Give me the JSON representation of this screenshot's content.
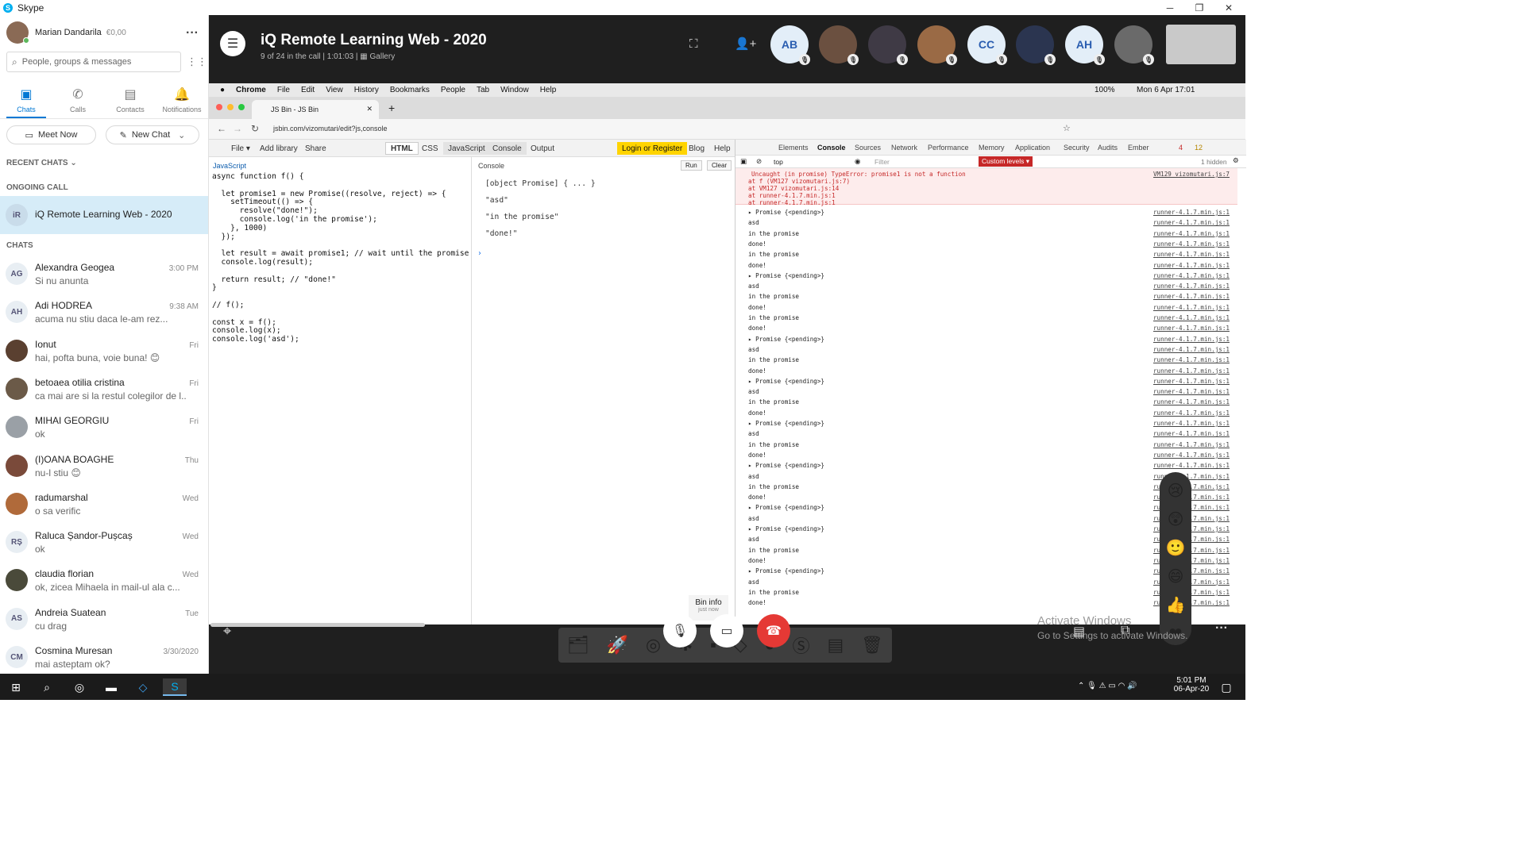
{
  "window": {
    "title": "Skype"
  },
  "profile": {
    "name": "Marian Dandarila",
    "credit": "€0,00"
  },
  "search": {
    "placeholder": "People, groups & messages"
  },
  "nav": [
    {
      "label": "Chats"
    },
    {
      "label": "Calls"
    },
    {
      "label": "Contacts"
    },
    {
      "label": "Notifications"
    }
  ],
  "buttons": {
    "meet_now": "Meet Now",
    "new_chat": "New Chat"
  },
  "sections": {
    "recent": "RECENT CHATS",
    "ongoing": "ONGOING CALL",
    "chats": "CHATS"
  },
  "ongoing_call": {
    "initials": "iR",
    "name": "iQ Remote Learning Web - 2020"
  },
  "chats": [
    {
      "initials": "AG",
      "name": "Alexandra Geogea",
      "msg": "Si nu anunta",
      "time": "3:00 PM",
      "color": "#e8eef3"
    },
    {
      "initials": "AH",
      "name": "Adi HODREA",
      "msg": "acuma nu stiu daca le-am rez...",
      "time": "9:38 AM",
      "color": "#e8eef3"
    },
    {
      "initials": "",
      "name": "Ionut",
      "msg": "hai, pofta buna, voie buna! 😊",
      "time": "Fri",
      "color": "#5a4030"
    },
    {
      "initials": "",
      "name": "betoaea otilia cristina",
      "msg": "ca mai are si la restul colegilor de l...",
      "time": "Fri",
      "color": "#6b5a48"
    },
    {
      "initials": "",
      "name": "MIHAI GEORGIU",
      "msg": "ok",
      "time": "Fri",
      "color": "#9aa0a6"
    },
    {
      "initials": "",
      "name": "(I)OANA BOAGHE",
      "msg": "nu-l stiu 😊",
      "time": "Thu",
      "color": "#7a4a3a"
    },
    {
      "initials": "",
      "name": "radumarshal",
      "msg": "o sa verific",
      "time": "Wed",
      "color": "#b06a3a"
    },
    {
      "initials": "RȘ",
      "name": "Raluca Șandor-Pușcaș",
      "msg": "ok",
      "time": "Wed",
      "color": "#e8eef3"
    },
    {
      "initials": "",
      "name": "claudia florian",
      "msg": "ok, zicea Mihaela in mail-ul ala c...",
      "time": "Wed",
      "color": "#4a4a3a"
    },
    {
      "initials": "AS",
      "name": "Andreia Suatean",
      "msg": "cu drag",
      "time": "Tue",
      "color": "#e8eef3"
    },
    {
      "initials": "CM",
      "name": "Cosmina Muresan",
      "msg": "mai asteptam ok?",
      "time": "3/30/2020",
      "color": "#e8eef3"
    }
  ],
  "call": {
    "title": "iQ Remote Learning Web - 2020",
    "subtitle": "9 of 24 in the call | 1:01:03 |",
    "view": "Gallery"
  },
  "participants": [
    {
      "initials": "AB"
    },
    {
      "initials": ""
    },
    {
      "initials": ""
    },
    {
      "initials": ""
    },
    {
      "initials": "CC"
    },
    {
      "initials": ""
    },
    {
      "initials": "AH"
    },
    {
      "initials": ""
    }
  ],
  "mac_menu": {
    "app": "Chrome",
    "items": [
      "File",
      "Edit",
      "View",
      "History",
      "Bookmarks",
      "People",
      "Tab",
      "Window",
      "Help"
    ],
    "battery": "100%",
    "clock": "Mon 6 Apr  17:01"
  },
  "browser": {
    "tab": "JS Bin - JS Bin",
    "url": "jsbin.com/vizomutari/edit?js,console"
  },
  "jsbin": {
    "file": "File",
    "add_library": "Add library",
    "share": "Share",
    "tabs": [
      "HTML",
      "CSS",
      "JavaScript",
      "Console",
      "Output"
    ],
    "login": "Login or Register",
    "blog": "Blog",
    "help": "Help",
    "lang": "JavaScript",
    "code": "async function f() {\n\n  let promise1 = new Promise((resolve, reject) => {\n    setTimeout(() => {\n      resolve(\"done!\");\n      console.log('in the promise');\n    }, 1000)\n  });\n\n  let result = await promise1; // wait until the promise\n  console.log(result);\n\n  return result; // \"done!\"\n}\n\n// f();\n\nconst x = f();\nconsole.log(x);\nconsole.log('asd');",
    "console_title": "Console",
    "run": "Run",
    "clear": "Clear",
    "console_lines": [
      "[object Promise] { ... }",
      "\"asd\"",
      "\"in the promise\"",
      "\"done!\""
    ],
    "bin_info": "Bin info",
    "bin_time": "just now"
  },
  "devtools": {
    "tabs": [
      "Elements",
      "Console",
      "Sources",
      "Network",
      "Performance",
      "Memory",
      "Application",
      "Security",
      "Audits",
      "Ember"
    ],
    "errors": "4",
    "warnings": "12",
    "context": "top",
    "filter_placeholder": "Filter",
    "levels": "Custom levels ▾",
    "hidden": "1 hidden",
    "error_lines": [
      "Uncaught (in promise) TypeError: promise1 is not a function",
      "    at f (VM127 vizomutari.js:7)",
      "    at VM127 vizomutari.js:14",
      "    at runner-4.1.7.min.js:1",
      "    at runner-4.1.7.min.js:1"
    ],
    "error_src": "VM129 vizomutari.js:7",
    "log_src": "runner-4.1.7.min.js:1",
    "logs": [
      "▸ Promise {<pending>}",
      "asd",
      "in the promise",
      "done!",
      "in the promise",
      "done!",
      "▸ Promise {<pending>}",
      "asd",
      "in the promise",
      "done!",
      "in the promise",
      "done!",
      "▸ Promise {<pending>}",
      "asd",
      "in the promise",
      "done!",
      "▸ Promise {<pending>}",
      "asd",
      "in the promise",
      "done!",
      "▸ Promise {<pending>}",
      "asd",
      "in the promise",
      "done!",
      "▸ Promise {<pending>}",
      "asd",
      "in the promise",
      "done!",
      "▸ Promise {<pending>}",
      "asd",
      "▸ Promise {<pending>}",
      "asd",
      "in the promise",
      "done!",
      "▸ Promise {<pending>}",
      "asd",
      "in the promise",
      "done!"
    ]
  },
  "watermark": {
    "line1": "Activate Windows",
    "line2": "Go to Settings to activate Windows."
  },
  "taskbar": {
    "time": "5:01 PM",
    "date": "06-Apr-20"
  }
}
